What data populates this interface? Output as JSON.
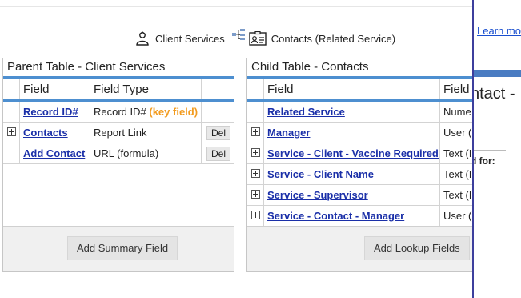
{
  "header": {
    "client_services": "Client Services",
    "contacts_related": "Contacts (Related Service)"
  },
  "parent": {
    "title": "Parent Table - Client Services",
    "columns": [
      "Field",
      "Field Type"
    ],
    "rows": [
      {
        "expand": false,
        "name": "Record ID#",
        "type": "Record ID#",
        "key": "(key field)",
        "del": ""
      },
      {
        "expand": true,
        "name": "Contacts",
        "type": "Report Link",
        "key": "",
        "del": "Del"
      },
      {
        "expand": false,
        "name": "Add Contact",
        "type": "URL (formula)",
        "key": "",
        "del": "Del"
      }
    ],
    "button": "Add Summary Field"
  },
  "child": {
    "title": "Child Table - Contacts",
    "columns": [
      "Field",
      "Field"
    ],
    "rows": [
      {
        "expand": false,
        "name": "Related Service",
        "type": "Nume"
      },
      {
        "expand": true,
        "name": "Manager",
        "type": "User ("
      },
      {
        "expand": true,
        "name": "Service - Client - Vaccine Required?",
        "type": "Text (I"
      },
      {
        "expand": true,
        "name": "Service - Client Name",
        "type": "Text (I"
      },
      {
        "expand": true,
        "name": "Service - Supervisor",
        "type": "Text (I"
      },
      {
        "expand": true,
        "name": "Service - Contact - Manager",
        "type": "User ("
      }
    ],
    "button": "Add Lookup Fields"
  },
  "right_panel": {
    "learn_more": "Learn more",
    "heading": "ntact -",
    "subtext": "d for:"
  },
  "icons": [
    "people-icon",
    "relationship-tree-icon",
    "contact-card-icon",
    "plus-expand-icon"
  ],
  "colors": {
    "accent": "#4d8fd0",
    "link": "#1a2fa8",
    "key": "#f29b1f",
    "pane_border": "#3d3f9d"
  }
}
